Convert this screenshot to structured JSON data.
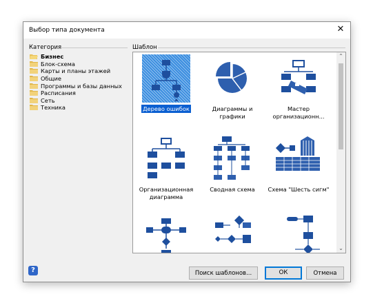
{
  "dialog": {
    "title": "Выбор типа документа",
    "close_glyph": "✕",
    "help_glyph": "?"
  },
  "categories": {
    "label": "Категория",
    "items": [
      {
        "label": "Бизнес",
        "selected": true
      },
      {
        "label": "Блок-схема"
      },
      {
        "label": "Карты и планы этажей"
      },
      {
        "label": "Общие"
      },
      {
        "label": "Программы и базы данных"
      },
      {
        "label": "Расписания"
      },
      {
        "label": "Сеть"
      },
      {
        "label": "Техника"
      }
    ]
  },
  "templates": {
    "label": "Шаблон",
    "items": [
      {
        "label": "Дерево ошибок",
        "icon": "fault-tree-icon",
        "selected": true
      },
      {
        "label": "Диаграммы и графики",
        "icon": "pie-chart-icon"
      },
      {
        "label": "Мастер организационн...",
        "icon": "org-wizard-icon"
      },
      {
        "label": "Организационная диаграмма",
        "icon": "org-chart-icon"
      },
      {
        "label": "Сводная схема",
        "icon": "pivot-diagram-icon"
      },
      {
        "label": "Схема \"Шесть сигм\"",
        "icon": "six-sigma-icon"
      },
      {
        "label": "",
        "icon": "flowchart-icon"
      },
      {
        "label": "",
        "icon": "process-flow-icon"
      },
      {
        "label": "",
        "icon": "decision-flow-icon"
      }
    ],
    "scroll_up_glyph": "⌃",
    "scroll_down_glyph": "⌄"
  },
  "buttons": {
    "search": "Поиск шаблонов...",
    "ok": "ОК",
    "cancel": "Отмена"
  },
  "colors": {
    "icon_blue": "#2e5fae",
    "selection": "#0b5fd1",
    "folder": "#e8c15a"
  }
}
